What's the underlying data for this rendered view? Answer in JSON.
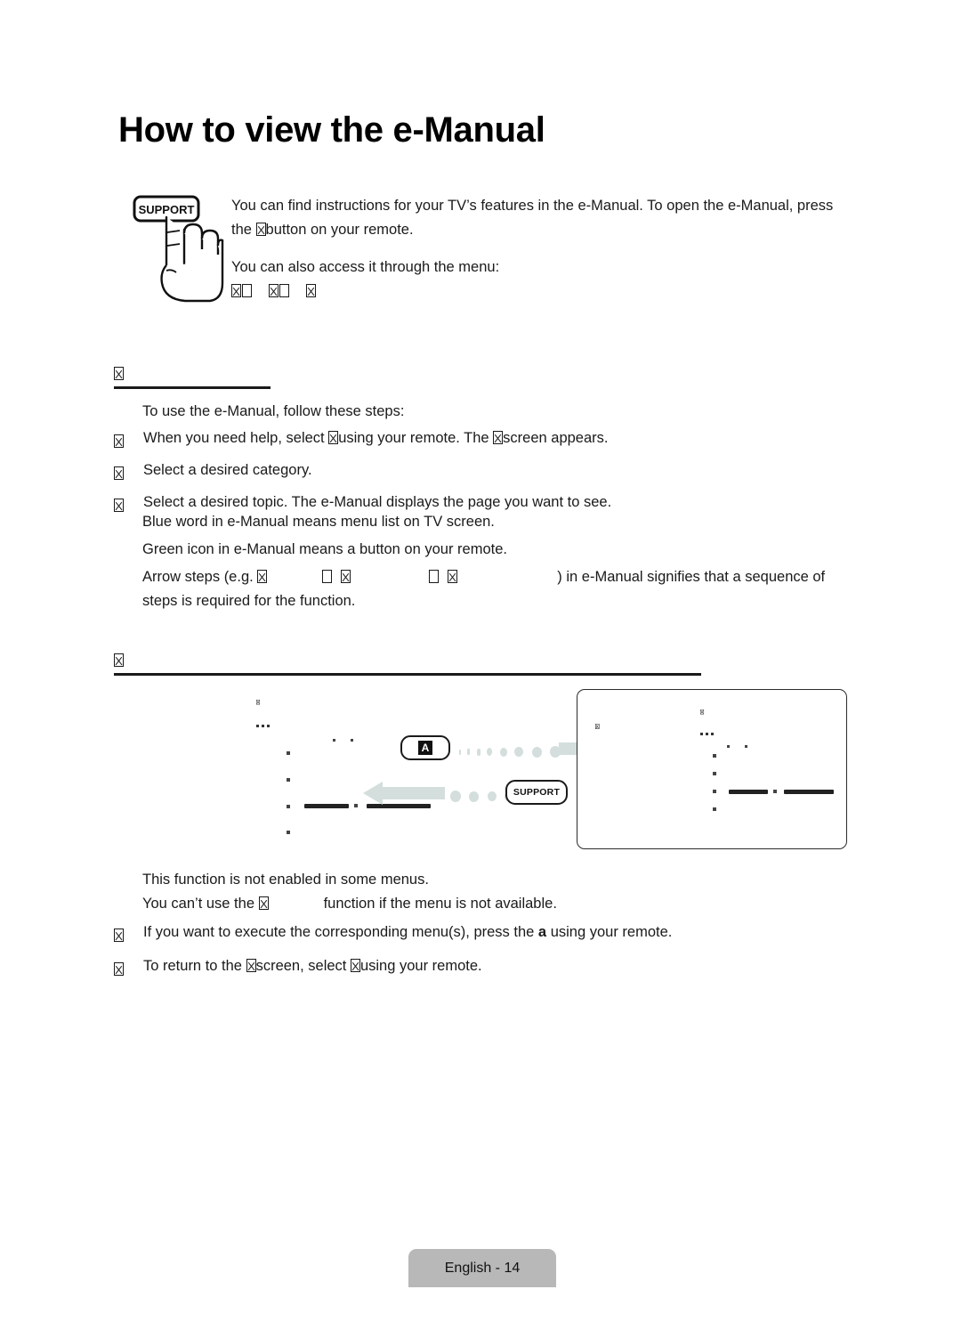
{
  "page": {
    "title": "How to view the e-Manual",
    "footer_label": "English - 14"
  },
  "illustration": {
    "support_button_label": "SUPPORT"
  },
  "intro": {
    "paragraph_1_part_1": "You can find instructions for your TV’s features in the e-Manual. To open the e-Manual, press the ",
    "paragraph_1_part_2": "button on your remote.",
    "paragraph_2": "You can also access it through the menu:"
  },
  "section_1": {
    "lead": "To use the e-Manual, follow these steps:",
    "steps": [
      {
        "text_part_1": "When you need help, select ",
        "text_part_2": "using your remote. The ",
        "text_part_3": "screen appears."
      },
      {
        "text_part_1": "Select a desired category."
      },
      {
        "text_part_1": "Select a desired topic. The e-Manual displays the page you want to see."
      }
    ],
    "notes": [
      "Blue word in e-Manual means menu list on TV screen.",
      "Green icon in e-Manual means a button on your remote."
    ],
    "arrow_note_prefix": "Arrow steps (e.g. ",
    "arrow_note_suffix": ") in e-Manual signifies that a sequence of steps is required for the function."
  },
  "section_2": {
    "diagram": {
      "key_a_label": "A",
      "key_support_label": "SUPPORT"
    },
    "notes": [
      "This function is not enabled in some menus.",
      {
        "part_1": "You can’t use the ",
        "part_2": "function if the menu is not available."
      }
    ],
    "steps": [
      {
        "text_part_1": "If you want to execute the corresponding menu(s), press the ",
        "key": "a",
        "text_part_2": "using your remote."
      },
      {
        "text_part_1": "To return to the ",
        "text_part_2": "screen, select ",
        "text_part_3": "using your remote."
      }
    ]
  },
  "colors": {
    "arrow": "#d3dedd",
    "footer_tab": "#b8b8b8",
    "text": "#1a1a1a"
  }
}
